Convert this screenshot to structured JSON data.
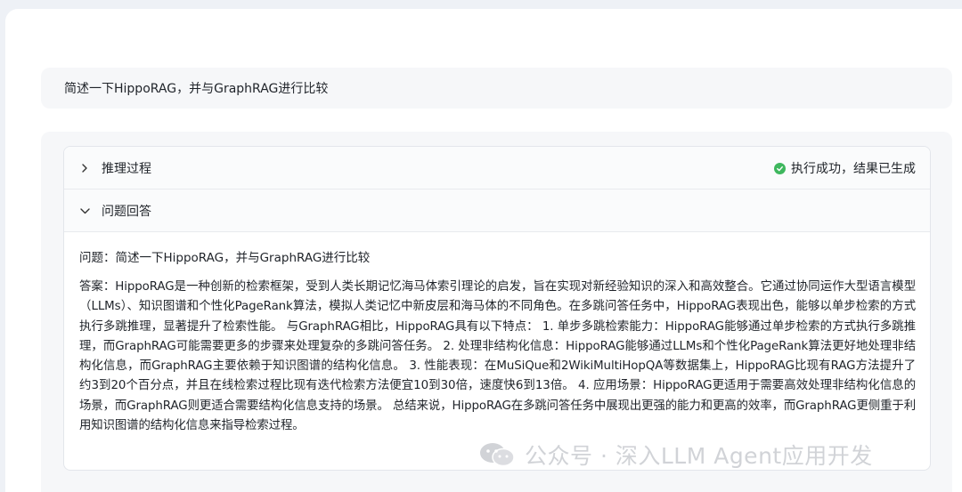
{
  "question": "简述一下HippoRAG，并与GraphRAG进行比较",
  "panels": {
    "reasoning_label": "推理过程",
    "qa_label": "问题回答"
  },
  "status": {
    "text": "执行成功，结果已生成",
    "color": "#3eb75e"
  },
  "answer": {
    "question_line": "问题：简述一下HippoRAG，并与GraphRAG进行比较",
    "text": "答案：HippoRAG是一种创新的检索框架，受到人类长期记忆海马体索引理论的启发，旨在实现对新经验知识的深入和高效整合。它通过协同运作大型语言模型（LLMs）、知识图谱和个性化PageRank算法，模拟人类记忆中新皮层和海马体的不同角色。在多跳问答任务中，HippoRAG表现出色，能够以单步检索的方式执行多跳推理，显著提升了检索性能。 与GraphRAG相比，HippoRAG具有以下特点： 1. 单步多跳检索能力：HippoRAG能够通过单步检索的方式执行多跳推理，而GraphRAG可能需要更多的步骤来处理复杂的多跳问答任务。 2. 处理非结构化信息：HippoRAG能够通过LLMs和个性化PageRank算法更好地处理非结构化信息，而GraphRAG主要依赖于知识图谱的结构化信息。 3. 性能表现：在MuSiQue和2WikiMultiHopQA等数据集上，HippoRAG比现有RAG方法提升了约3到20个百分点，并且在线检索过程比现有迭代检索方法便宜10到30倍，速度快6到13倍。 4. 应用场景：HippoRAG更适用于需要高效处理非结构化信息的场景，而GraphRAG则更适合需要结构化信息支持的场景。 总结来说，HippoRAG在多跳问答任务中展现出更强的能力和更高的效率，而GraphRAG更侧重于利用知识图谱的结构化信息来指导检索过程。"
  },
  "watermark": {
    "text": "公众号 · 深入LLM Agent应用开发",
    "icon": "wechat-logo-icon"
  }
}
